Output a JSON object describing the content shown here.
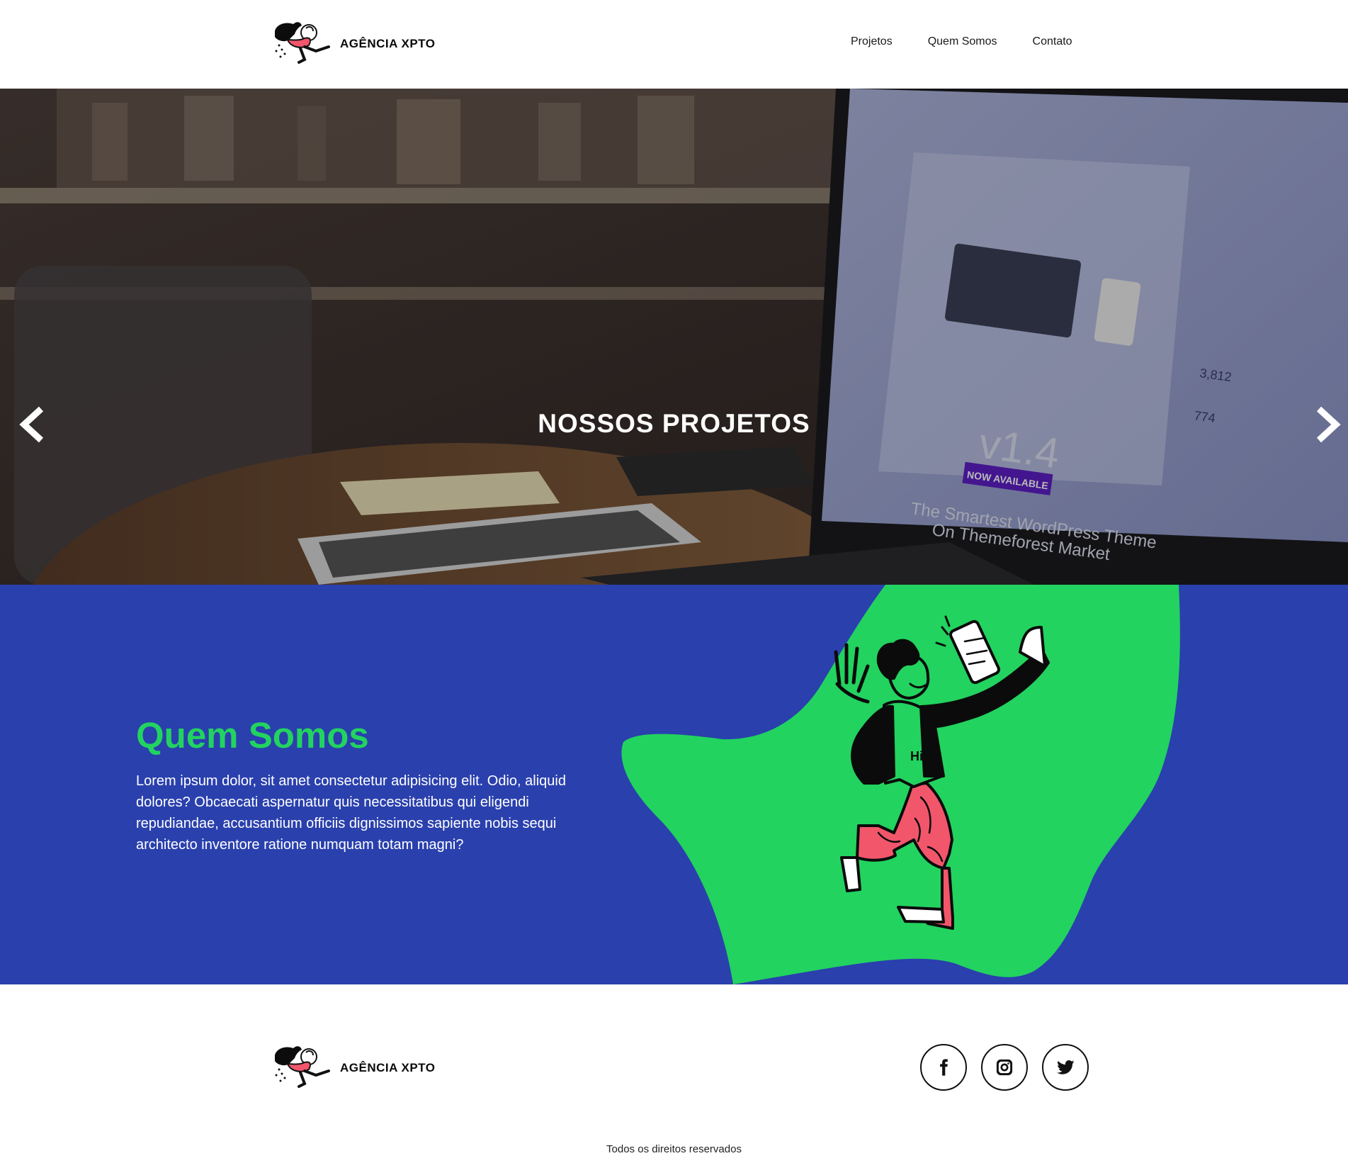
{
  "header": {
    "brand_name": "AGÊNCIA XPTO",
    "nav": [
      "Projetos",
      "Quem Somos",
      "Contato"
    ]
  },
  "hero": {
    "title": "NOSSOS PROJETOS",
    "prev_icon": "chevron-left-icon",
    "next_icon": "chevron-right-icon",
    "screen_text": {
      "version": "v1.4",
      "badge": "NOW AVAILABLE",
      "line1": "The Smartest WordPress Theme",
      "line2": "On Themeforest Market",
      "sales": "3,812",
      "comments": "774"
    }
  },
  "about": {
    "title": "Quem Somos",
    "text": "Lorem ipsum dolor, sit amet consectetur adipisicing elit. Odio, aliquid dolores? Obcaecati aspernatur quis necessitatibus qui eligendi repudiandae, accusantium officiis dignissimos sapiente nobis sequi architecto inventore ratione numquam totam magni?",
    "illustration_text": "Hi"
  },
  "footer": {
    "brand_name": "AGÊNCIA XPTO",
    "socials": [
      "facebook-icon",
      "instagram-icon",
      "twitter-icon"
    ],
    "copyright": "Todos os direitos reservados"
  },
  "colors": {
    "blue": "#2a40ad",
    "green": "#22d35f",
    "pink": "#f2566b"
  }
}
